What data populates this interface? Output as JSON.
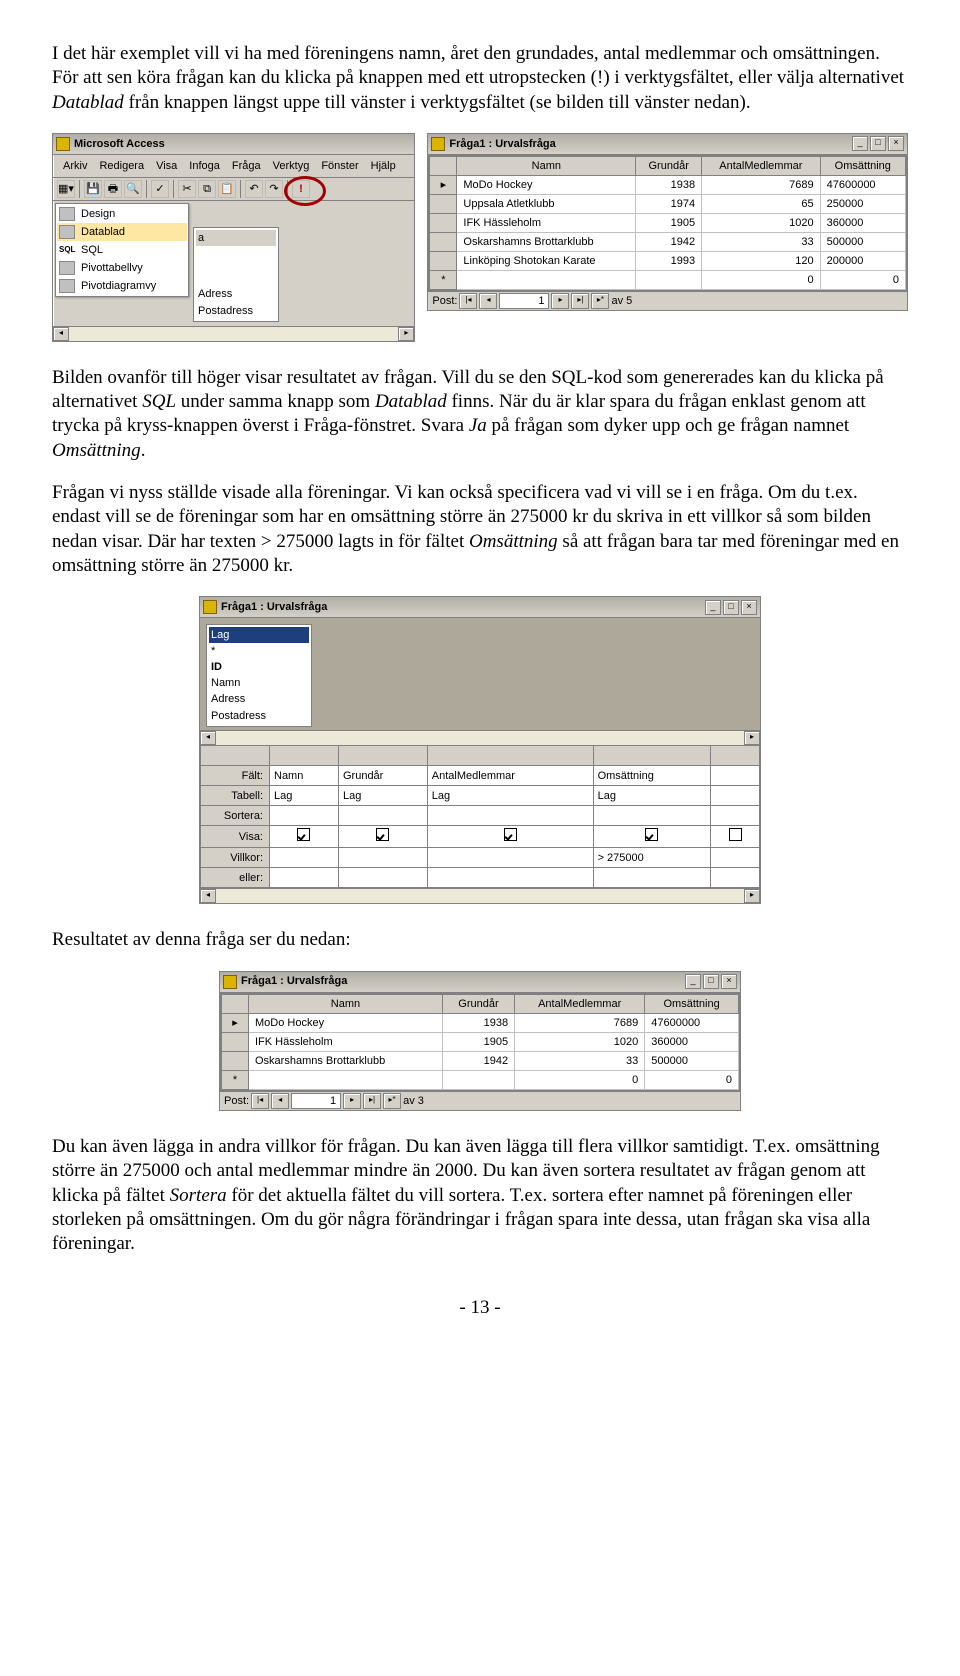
{
  "para1_a": "I det här exemplet vill vi ha med föreningens namn, året den grundades, antal medlemmar och omsättningen. För att sen köra frågan kan du klicka på knappen med ett utropstecken (!) i verktygsfältet, eller välja alternativet ",
  "para1_em": "Datablad",
  "para1_b": " från knappen längst uppe till vänster i verktygsfältet (se bilden till vänster nedan).",
  "img1_left": {
    "app_title": "Microsoft Access",
    "menus": [
      "Arkiv",
      "Redigera",
      "Visa",
      "Infoga",
      "Fråga",
      "Verktyg",
      "Fönster",
      "Hjälp"
    ],
    "view_options": [
      "Design",
      "Datablad",
      "SQL",
      "Pivottabellvy",
      "Pivotdiagramvy"
    ],
    "sql_abbr": "SQL",
    "fields_header": "a",
    "fields": [
      "Adress",
      "Postadress"
    ]
  },
  "img1_right": {
    "title": "Fråga1 : Urvalsfråga",
    "columns": [
      "Namn",
      "Grundår",
      "AntalMedlemmar",
      "Omsättning"
    ],
    "rows": [
      {
        "namn": "MoDo Hockey",
        "grund": "1938",
        "med": "7689",
        "oms": "47600000"
      },
      {
        "namn": "Uppsala Atletklubb",
        "grund": "1974",
        "med": "65",
        "oms": "250000"
      },
      {
        "namn": "IFK Hässleholm",
        "grund": "1905",
        "med": "1020",
        "oms": "360000"
      },
      {
        "namn": "Oskarshamns Brottarklubb",
        "grund": "1942",
        "med": "33",
        "oms": "500000"
      },
      {
        "namn": "Linköping Shotokan Karate",
        "grund": "1993",
        "med": "120",
        "oms": "200000"
      }
    ],
    "blank": {
      "med": "0",
      "oms": "0"
    },
    "post_label": "Post:",
    "record": "1",
    "of_label": "av 5"
  },
  "para2_a": "Bilden ovanför till höger visar resultatet av frågan. Vill du se den SQL-kod som genererades kan du klicka på alternativet ",
  "para2_em1": "SQL",
  "para2_b": " under samma knapp som ",
  "para2_em2": "Datablad",
  "para2_c": " finns. När du är klar spara du frågan enklast genom att trycka på kryss-knappen överst i Fråga-fönstret. Svara ",
  "para2_em3": "Ja",
  "para2_d": " på frågan som dyker upp och ge frågan namnet ",
  "para2_em4": "Omsättning",
  "para2_e": ".",
  "para3_a": "Frågan vi nyss ställde visade alla föreningar. Vi kan också specificera vad vi vill se i en fråga. Om du t.ex. endast vill se de föreningar som har en omsättning större än 275000 kr du skriva in ett villkor så som bilden nedan visar. Där har texten > 275000 lagts in för fältet ",
  "para3_em": "Omsättning",
  "para3_b": " så att frågan bara tar med föreningar med en omsättning större än 275000 kr.",
  "img2": {
    "title": "Fråga1 : Urvalsfråga",
    "table_name": "Lag",
    "table_fields": [
      "*",
      "ID",
      "Namn",
      "Adress",
      "Postadress"
    ],
    "row_labels": [
      "Fält:",
      "Tabell:",
      "Sortera:",
      "Visa:",
      "Villkor:",
      "eller:"
    ],
    "cols": [
      {
        "falt": "Namn",
        "tabell": "Lag",
        "visa": true,
        "villkor": ""
      },
      {
        "falt": "Grundår",
        "tabell": "Lag",
        "visa": true,
        "villkor": ""
      },
      {
        "falt": "AntalMedlemmar",
        "tabell": "Lag",
        "visa": true,
        "villkor": ""
      },
      {
        "falt": "Omsättning",
        "tabell": "Lag",
        "visa": true,
        "villkor": "> 275000"
      }
    ]
  },
  "para4": "Resultatet av denna fråga ser du nedan:",
  "img3": {
    "title": "Fråga1 : Urvalsfråga",
    "columns": [
      "Namn",
      "Grundår",
      "AntalMedlemmar",
      "Omsättning"
    ],
    "rows": [
      {
        "namn": "MoDo Hockey",
        "grund": "1938",
        "med": "7689",
        "oms": "47600000"
      },
      {
        "namn": "IFK Hässleholm",
        "grund": "1905",
        "med": "1020",
        "oms": "360000"
      },
      {
        "namn": "Oskarshamns Brottarklubb",
        "grund": "1942",
        "med": "33",
        "oms": "500000"
      }
    ],
    "blank": {
      "med": "0",
      "oms": "0"
    },
    "post_label": "Post:",
    "record": "1",
    "of_label": "av 3"
  },
  "para5_a": "Du kan även lägga in andra villkor för frågan. Du kan även lägga till flera villkor samtidigt. T.ex. omsättning större än 275000 och antal medlemmar mindre än 2000. Du kan även sortera resultatet av frågan genom att klicka på fältet ",
  "para5_em": "Sortera",
  "para5_b": " för det aktuella fältet du vill sortera. T.ex. sortera efter namnet på föreningen eller storleken på omsättningen. Om du gör några förändringar i frågan spara inte dessa, utan frågan ska visa alla föreningar.",
  "pagenum": "- 13 -"
}
